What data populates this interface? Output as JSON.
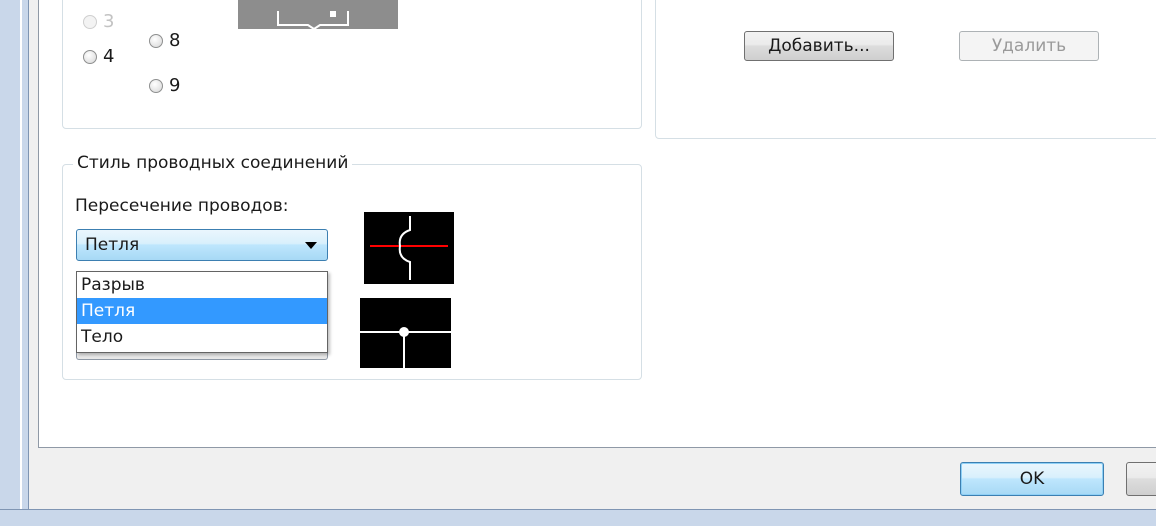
{
  "radios": {
    "col1": [
      "3",
      "4"
    ],
    "col2": [
      "8",
      "9"
    ]
  },
  "buttons": {
    "add": "Добавить...",
    "delete": "Удалить",
    "ok": "OK"
  },
  "wire_style": {
    "group_title": "Стиль проводных соединений",
    "crossing_label": "Пересечение проводов:",
    "selected_value": "Петля",
    "options": [
      "Разрыв",
      "Петля",
      "Тело"
    ],
    "highlighted_index": 1
  },
  "colors": {
    "selection": "#3399ff",
    "preview_background": "#000000",
    "crossing_line": "#ff0000",
    "default_button_border": "#3c7fb1"
  }
}
